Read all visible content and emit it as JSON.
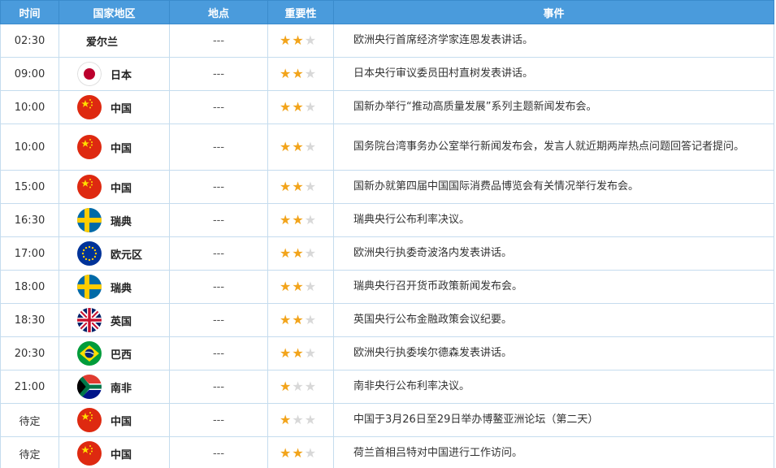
{
  "header": {
    "time": "时间",
    "country": "国家地区",
    "location": "地点",
    "importance": "重要性",
    "event": "事件"
  },
  "colors": {
    "header_bg": "#4a9bdc",
    "border": "#c5dcee",
    "star_on": "#f2a41b",
    "star_off": "#d8d8d8"
  },
  "rows": [
    {
      "time": "02:30",
      "country": "爱尔兰",
      "flag": "",
      "location": "---",
      "stars": 2,
      "event": "欧洲央行首席经济学家连恩发表讲话。"
    },
    {
      "time": "09:00",
      "country": "日本",
      "flag": "japan",
      "location": "---",
      "stars": 2,
      "event": "日本央行审议委员田村直树发表讲话。"
    },
    {
      "time": "10:00",
      "country": "中国",
      "flag": "china",
      "location": "---",
      "stars": 2,
      "event": "国新办举行“推动高质量发展”系列主题新闻发布会。"
    },
    {
      "time": "10:00",
      "country": "中国",
      "flag": "china",
      "location": "---",
      "stars": 2,
      "event": "国务院台湾事务办公室举行新闻发布会，发言人就近期两岸热点问题回答记者提问。"
    },
    {
      "time": "15:00",
      "country": "中国",
      "flag": "china",
      "location": "---",
      "stars": 2,
      "event": "国新办就第四届中国国际消费品博览会有关情况举行发布会。"
    },
    {
      "time": "16:30",
      "country": "瑞典",
      "flag": "sweden",
      "location": "---",
      "stars": 2,
      "event": "瑞典央行公布利率决议。"
    },
    {
      "time": "17:00",
      "country": "欧元区",
      "flag": "eu",
      "location": "---",
      "stars": 2,
      "event": "欧洲央行执委奇波洛内发表讲话。"
    },
    {
      "time": "18:00",
      "country": "瑞典",
      "flag": "sweden",
      "location": "---",
      "stars": 2,
      "event": "瑞典央行召开货币政策新闻发布会。"
    },
    {
      "time": "18:30",
      "country": "英国",
      "flag": "uk",
      "location": "---",
      "stars": 2,
      "event": "英国央行公布金融政策会议纪要。"
    },
    {
      "time": "20:30",
      "country": "巴西",
      "flag": "brazil",
      "location": "---",
      "stars": 2,
      "event": "欧洲央行执委埃尔德森发表讲话。"
    },
    {
      "time": "21:00",
      "country": "南非",
      "flag": "southafrica",
      "location": "---",
      "stars": 1,
      "event": "南非央行公布利率决议。"
    },
    {
      "time": "待定",
      "country": "中国",
      "flag": "china",
      "location": "---",
      "stars": 1,
      "event": "中国于3月26日至29日举办博鳌亚洲论坛（第二天）"
    },
    {
      "time": "待定",
      "country": "中国",
      "flag": "china",
      "location": "---",
      "stars": 2,
      "event": "荷兰首相吕特对中国进行工作访问。"
    }
  ]
}
